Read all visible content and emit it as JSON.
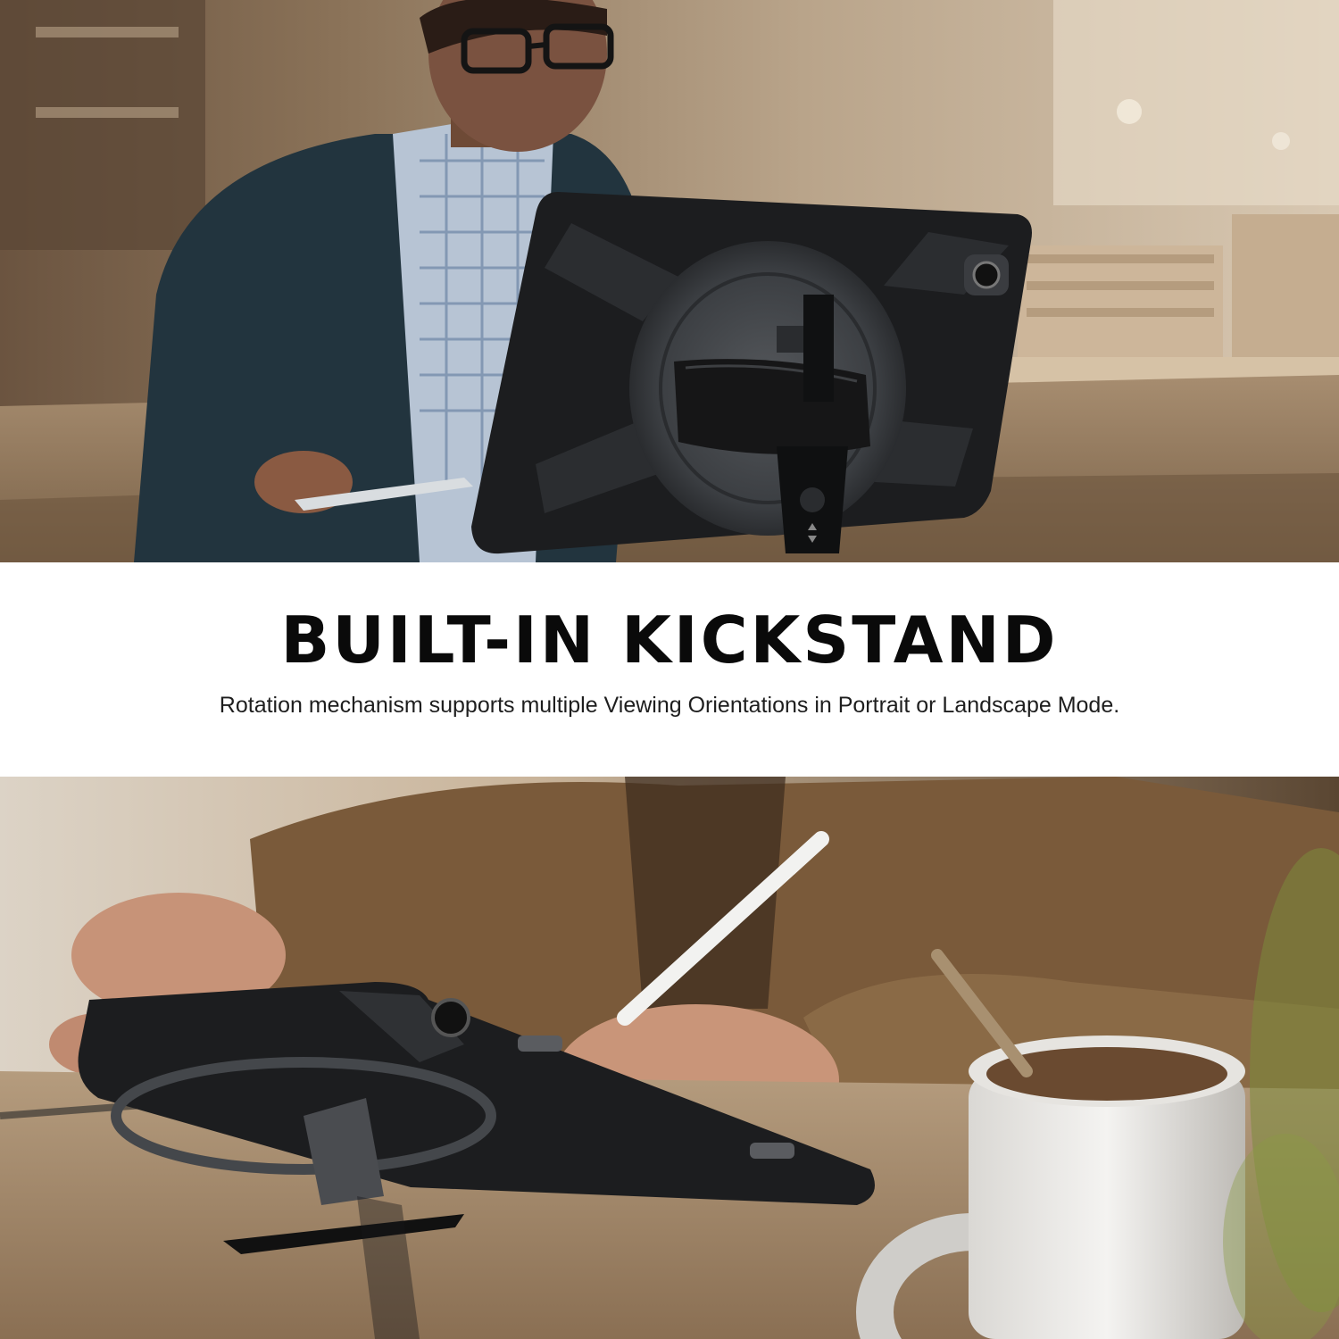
{
  "banner": {
    "headline": "BUILT-IN KICKSTAND",
    "subline": "Rotation mechanism supports multiple Viewing Orientations in Portrait or Landscape Mode."
  },
  "colors": {
    "headline": "#0a0a0a",
    "subline": "#1e1e1e",
    "case": "#1c1d1f",
    "background": "#ffffff"
  }
}
